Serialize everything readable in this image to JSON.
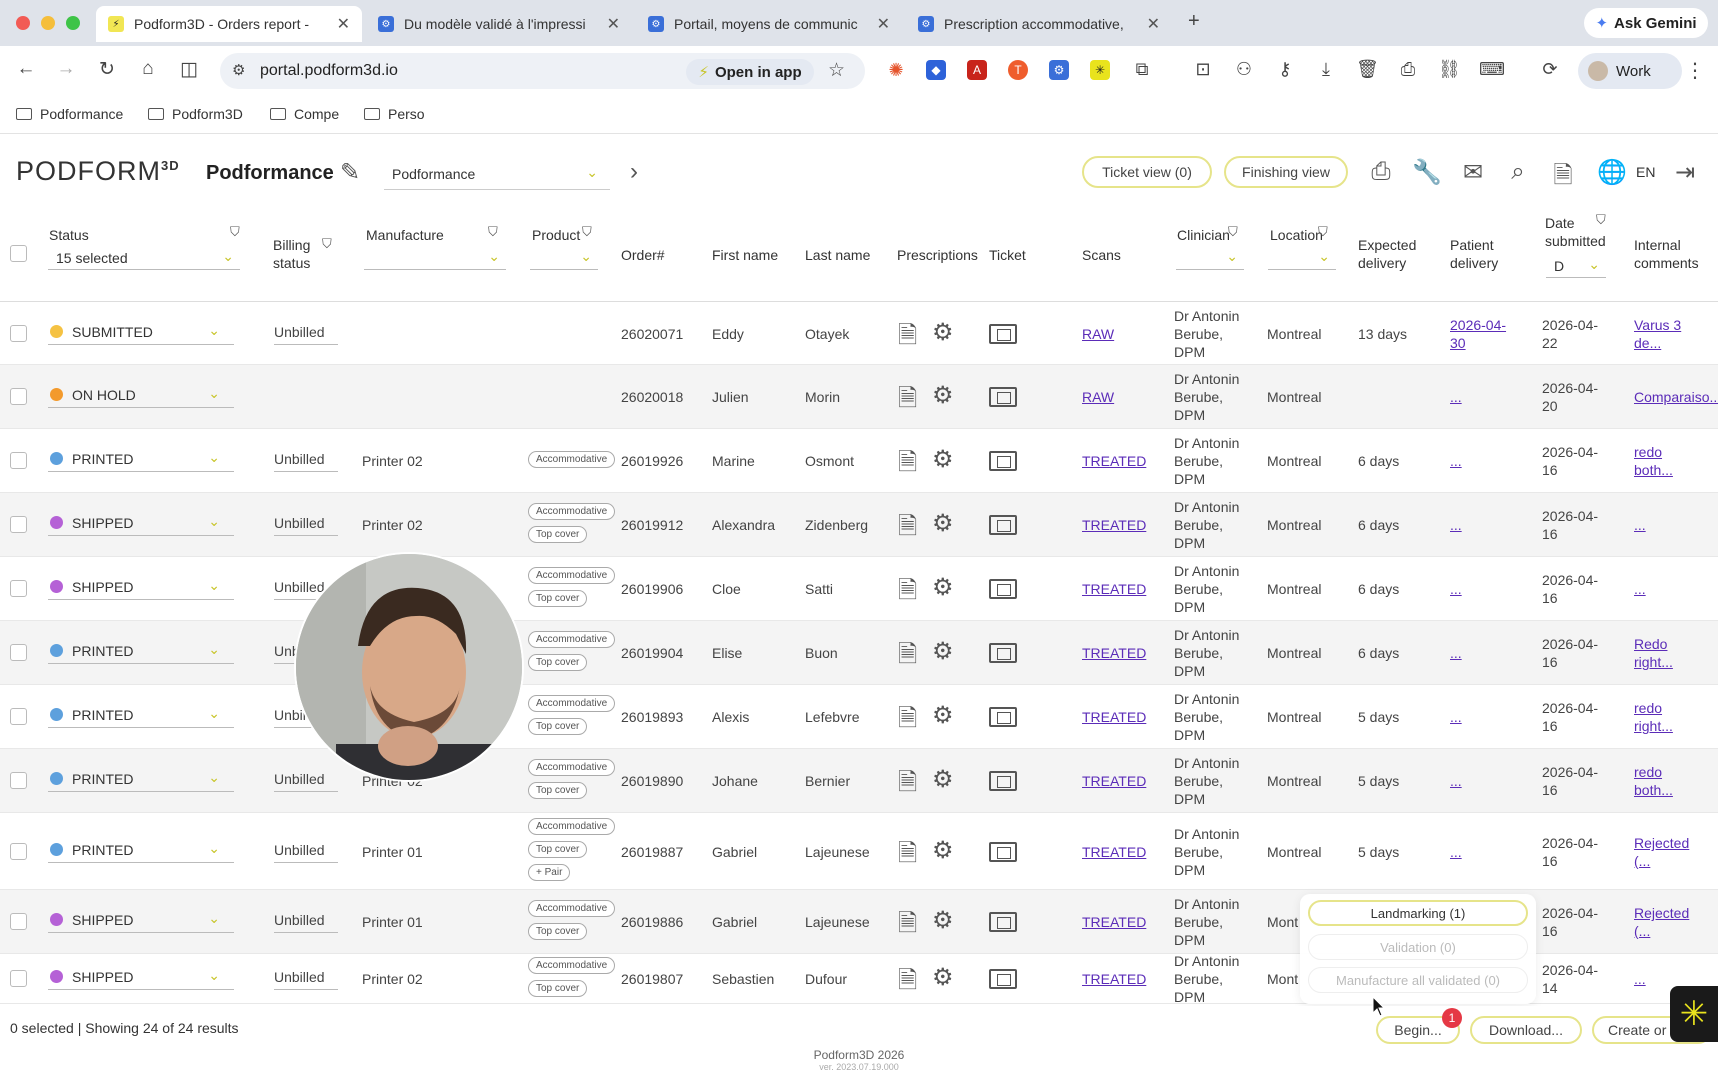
{
  "browser": {
    "tabs": [
      {
        "label": "Podform3D - Orders report -",
        "icon_color": "#2b2b2b",
        "active": true
      },
      {
        "label": "Du modèle validé à l'impressi",
        "icon_color": "#3a6fd8",
        "active": false
      },
      {
        "label": "Portail, moyens de communic",
        "icon_color": "#3a6fd8",
        "active": false
      },
      {
        "label": "Prescription accommodative,",
        "icon_color": "#3a6fd8",
        "active": false
      }
    ],
    "ask_gemini": "Ask Gemini",
    "url": "portal.podform3d.io",
    "open_in_app": "Open in app",
    "profile": "Work",
    "bookmarks": [
      "Podformance",
      "Podform3D",
      "Compe",
      "Perso"
    ]
  },
  "app": {
    "logo": "PODFORM",
    "logo_sup": "3D",
    "org_name": "Podformance",
    "org_select": "Podformance",
    "ticket_view": "Ticket view (0)",
    "finishing_view": "Finishing view",
    "lang": "EN"
  },
  "table": {
    "headers": {
      "status": "Status",
      "status_selected": "15 selected",
      "billing": "Billing status",
      "manufacture": "Manufacture",
      "product": "Product",
      "order": "Order#",
      "first": "First name",
      "last": "Last name",
      "prescriptions": "Prescriptions",
      "ticket": "Ticket",
      "scans": "Scans",
      "clinician": "Clinician",
      "location": "Location",
      "expected": "Expected delivery",
      "patient": "Patient delivery",
      "date": "Date submitted",
      "date_input": "D",
      "comments": "Internal comments"
    },
    "rows": [
      {
        "status": "SUBMITTED",
        "dot": "#f5c243",
        "billing": "Unbilled",
        "manufacture": "",
        "tags": [],
        "order": "26020071",
        "first": "Eddy",
        "last": "Otayek",
        "scan": "RAW",
        "clinician": [
          "Dr Antonin",
          "Berube,",
          "DPM"
        ],
        "location": "Montreal",
        "expected": "13 days",
        "patient": [
          "2026-04-",
          "30"
        ],
        "date": [
          "2026-04-",
          "22"
        ],
        "comment": [
          "Varus 3",
          "de..."
        ]
      },
      {
        "status": "ON HOLD",
        "dot": "#f39a2c",
        "billing": "",
        "manufacture": "",
        "tags": [],
        "order": "26020018",
        "first": "Julien",
        "last": "Morin",
        "scan": "RAW",
        "clinician": [
          "Dr Antonin",
          "Berube,",
          "DPM"
        ],
        "location": "Montreal",
        "expected": "",
        "patient": [
          "..."
        ],
        "date": [
          "2026-04-",
          "20"
        ],
        "comment": [
          "Comparaiso..."
        ]
      },
      {
        "status": "PRINTED",
        "dot": "#5da0dd",
        "billing": "Unbilled",
        "manufacture": "Printer 02",
        "tags": [
          "Accommodative"
        ],
        "order": "26019926",
        "first": "Marine",
        "last": "Osmont",
        "scan": "TREATED",
        "clinician": [
          "Dr Antonin",
          "Berube,",
          "DPM"
        ],
        "location": "Montreal",
        "expected": "6 days",
        "patient": [
          "..."
        ],
        "date": [
          "2026-04-",
          "16"
        ],
        "comment": [
          "redo",
          "both..."
        ]
      },
      {
        "status": "SHIPPED",
        "dot": "#b561d6",
        "billing": "Unbilled",
        "manufacture": "Printer 02",
        "tags": [
          "Accommodative",
          "Top cover"
        ],
        "order": "26019912",
        "first": "Alexandra",
        "last": "Zidenberg",
        "scan": "TREATED",
        "clinician": [
          "Dr Antonin",
          "Berube,",
          "DPM"
        ],
        "location": "Montreal",
        "expected": "6 days",
        "patient": [
          "..."
        ],
        "date": [
          "2026-04-",
          "16"
        ],
        "comment": [
          "..."
        ]
      },
      {
        "status": "SHIPPED",
        "dot": "#b561d6",
        "billing": "Unbilled",
        "manufacture": "",
        "tags": [
          "Accommodative",
          "Top cover"
        ],
        "order": "26019906",
        "first": "Cloe",
        "last": "Satti",
        "scan": "TREATED",
        "clinician": [
          "Dr Antonin",
          "Berube,",
          "DPM"
        ],
        "location": "Montreal",
        "expected": "6 days",
        "patient": [
          "..."
        ],
        "date": [
          "2026-04-",
          "16"
        ],
        "comment": [
          "..."
        ]
      },
      {
        "status": "PRINTED",
        "dot": "#5da0dd",
        "billing": "Unb",
        "manufacture": "",
        "tags": [
          "Accommodative",
          "Top cover"
        ],
        "order": "26019904",
        "first": "Elise",
        "last": "Buon",
        "scan": "TREATED",
        "clinician": [
          "Dr Antonin",
          "Berube,",
          "DPM"
        ],
        "location": "Montreal",
        "expected": "6 days",
        "patient": [
          "..."
        ],
        "date": [
          "2026-04-",
          "16"
        ],
        "comment": [
          "Redo",
          "right..."
        ]
      },
      {
        "status": "PRINTED",
        "dot": "#5da0dd",
        "billing": "Unbil",
        "manufacture": "",
        "tags": [
          "Accommodative",
          "Top cover"
        ],
        "order": "26019893",
        "first": "Alexis",
        "last": "Lefebvre",
        "scan": "TREATED",
        "clinician": [
          "Dr Antonin",
          "Berube,",
          "DPM"
        ],
        "location": "Montreal",
        "expected": "5 days",
        "patient": [
          "..."
        ],
        "date": [
          "2026-04-",
          "16"
        ],
        "comment": [
          "redo",
          "right..."
        ]
      },
      {
        "status": "PRINTED",
        "dot": "#5da0dd",
        "billing": "Unbilled",
        "manufacture": "Printer 02",
        "tags": [
          "Accommodative",
          "Top cover"
        ],
        "order": "26019890",
        "first": "Johane",
        "last": "Bernier",
        "scan": "TREATED",
        "clinician": [
          "Dr Antonin",
          "Berube,",
          "DPM"
        ],
        "location": "Montreal",
        "expected": "5 days",
        "patient": [
          "..."
        ],
        "date": [
          "2026-04-",
          "16"
        ],
        "comment": [
          "redo",
          "both..."
        ]
      },
      {
        "status": "PRINTED",
        "dot": "#5da0dd",
        "billing": "Unbilled",
        "manufacture": "Printer 01",
        "tags": [
          "Accommodative",
          "Top cover",
          "+ Pair"
        ],
        "order": "26019887",
        "first": "Gabriel",
        "last": "Lajeunese",
        "scan": "TREATED",
        "clinician": [
          "Dr Antonin",
          "Berube,",
          "DPM"
        ],
        "location": "Montreal",
        "expected": "5 days",
        "patient": [
          "..."
        ],
        "date": [
          "2026-04-",
          "16"
        ],
        "comment": [
          "Rejected",
          "(..."
        ]
      },
      {
        "status": "SHIPPED",
        "dot": "#b561d6",
        "billing": "Unbilled",
        "manufacture": "Printer 01",
        "tags": [
          "Accommodative",
          "Top cover"
        ],
        "order": "26019886",
        "first": "Gabriel",
        "last": "Lajeunese",
        "scan": "TREATED",
        "clinician": [
          "Dr Antonin",
          "Berube,",
          "DPM"
        ],
        "location": "Mont",
        "expected": "",
        "patient": [],
        "date": [
          "2026-04-",
          "16"
        ],
        "comment": [
          "Rejected",
          "(..."
        ]
      },
      {
        "status": "SHIPPED",
        "dot": "#b561d6",
        "billing": "Unbilled",
        "manufacture": "Printer 02",
        "tags": [
          "Accommodative",
          "Top cover"
        ],
        "order": "26019807",
        "first": "Sebastien",
        "last": "Dufour",
        "scan": "TREATED",
        "clinician": [
          "Dr Antonin",
          "Berube,",
          "DPM"
        ],
        "location": "Mont",
        "expected": "",
        "patient": [],
        "date": [
          "2026-04-",
          "14"
        ],
        "comment": [
          "..."
        ]
      }
    ]
  },
  "popup": {
    "landmarking": "Landmarking (1)",
    "validation": "Validation (0)",
    "manufacture_all": "Manufacture all validated (0)"
  },
  "footer": {
    "summary": "0 selected | Showing 24 of 24 results",
    "begin": "Begin...",
    "begin_badge": "1",
    "download": "Download...",
    "create": "Create or",
    "copyright": "Podform3D 2026",
    "version": "ver. 2023.07.19.000"
  }
}
